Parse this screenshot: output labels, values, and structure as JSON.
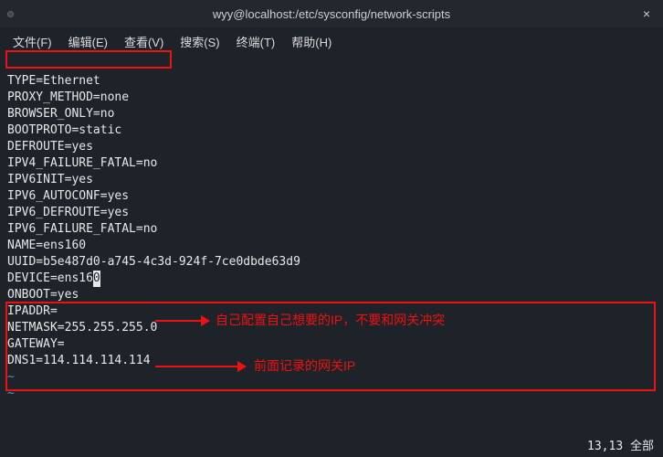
{
  "titlebar": {
    "title": "wyy@localhost:/etc/sysconfig/network-scripts"
  },
  "menubar": {
    "file": "文件(F)",
    "edit": "编辑(E)",
    "view": "查看(V)",
    "search": "搜索(S)",
    "terminal": "终端(T)",
    "help": "帮助(H)"
  },
  "config": {
    "type": "TYPE=Ethernet",
    "proxy_method": "PROXY_METHOD=none",
    "browser_only": "BROWSER_ONLY=no",
    "bootproto": "BOOTPROTO=static",
    "defroute": "DEFROUTE=yes",
    "ipv4_failure_fatal": "IPV4_FAILURE_FATAL=no",
    "ipv6init": "IPV6INIT=yes",
    "ipv6_autoconf": "IPV6_AUTOCONF=yes",
    "ipv6_defroute": "IPV6_DEFROUTE=yes",
    "ipv6_failure_fatal": "IPV6_FAILURE_FATAL=no",
    "name": "NAME=ens160",
    "uuid": "UUID=b5e487d0-a745-4c3d-924f-7ce0dbde63d9",
    "device_prefix": "DEVICE=ens16",
    "device_cursor": "0",
    "onboot": "ONBOOT=yes",
    "ipaddr": "IPADDR=",
    "netmask": "NETMASK=255.255.255.0",
    "gateway": "GATEWAY=",
    "dns1": "DNS1=114.114.114.114"
  },
  "annotations": {
    "ip_note": "自己配置自己想要的IP，不要和网关冲突",
    "gateway_note": "前面记录的网关IP"
  },
  "status": {
    "pos": "13,13",
    "mode": "全部"
  }
}
